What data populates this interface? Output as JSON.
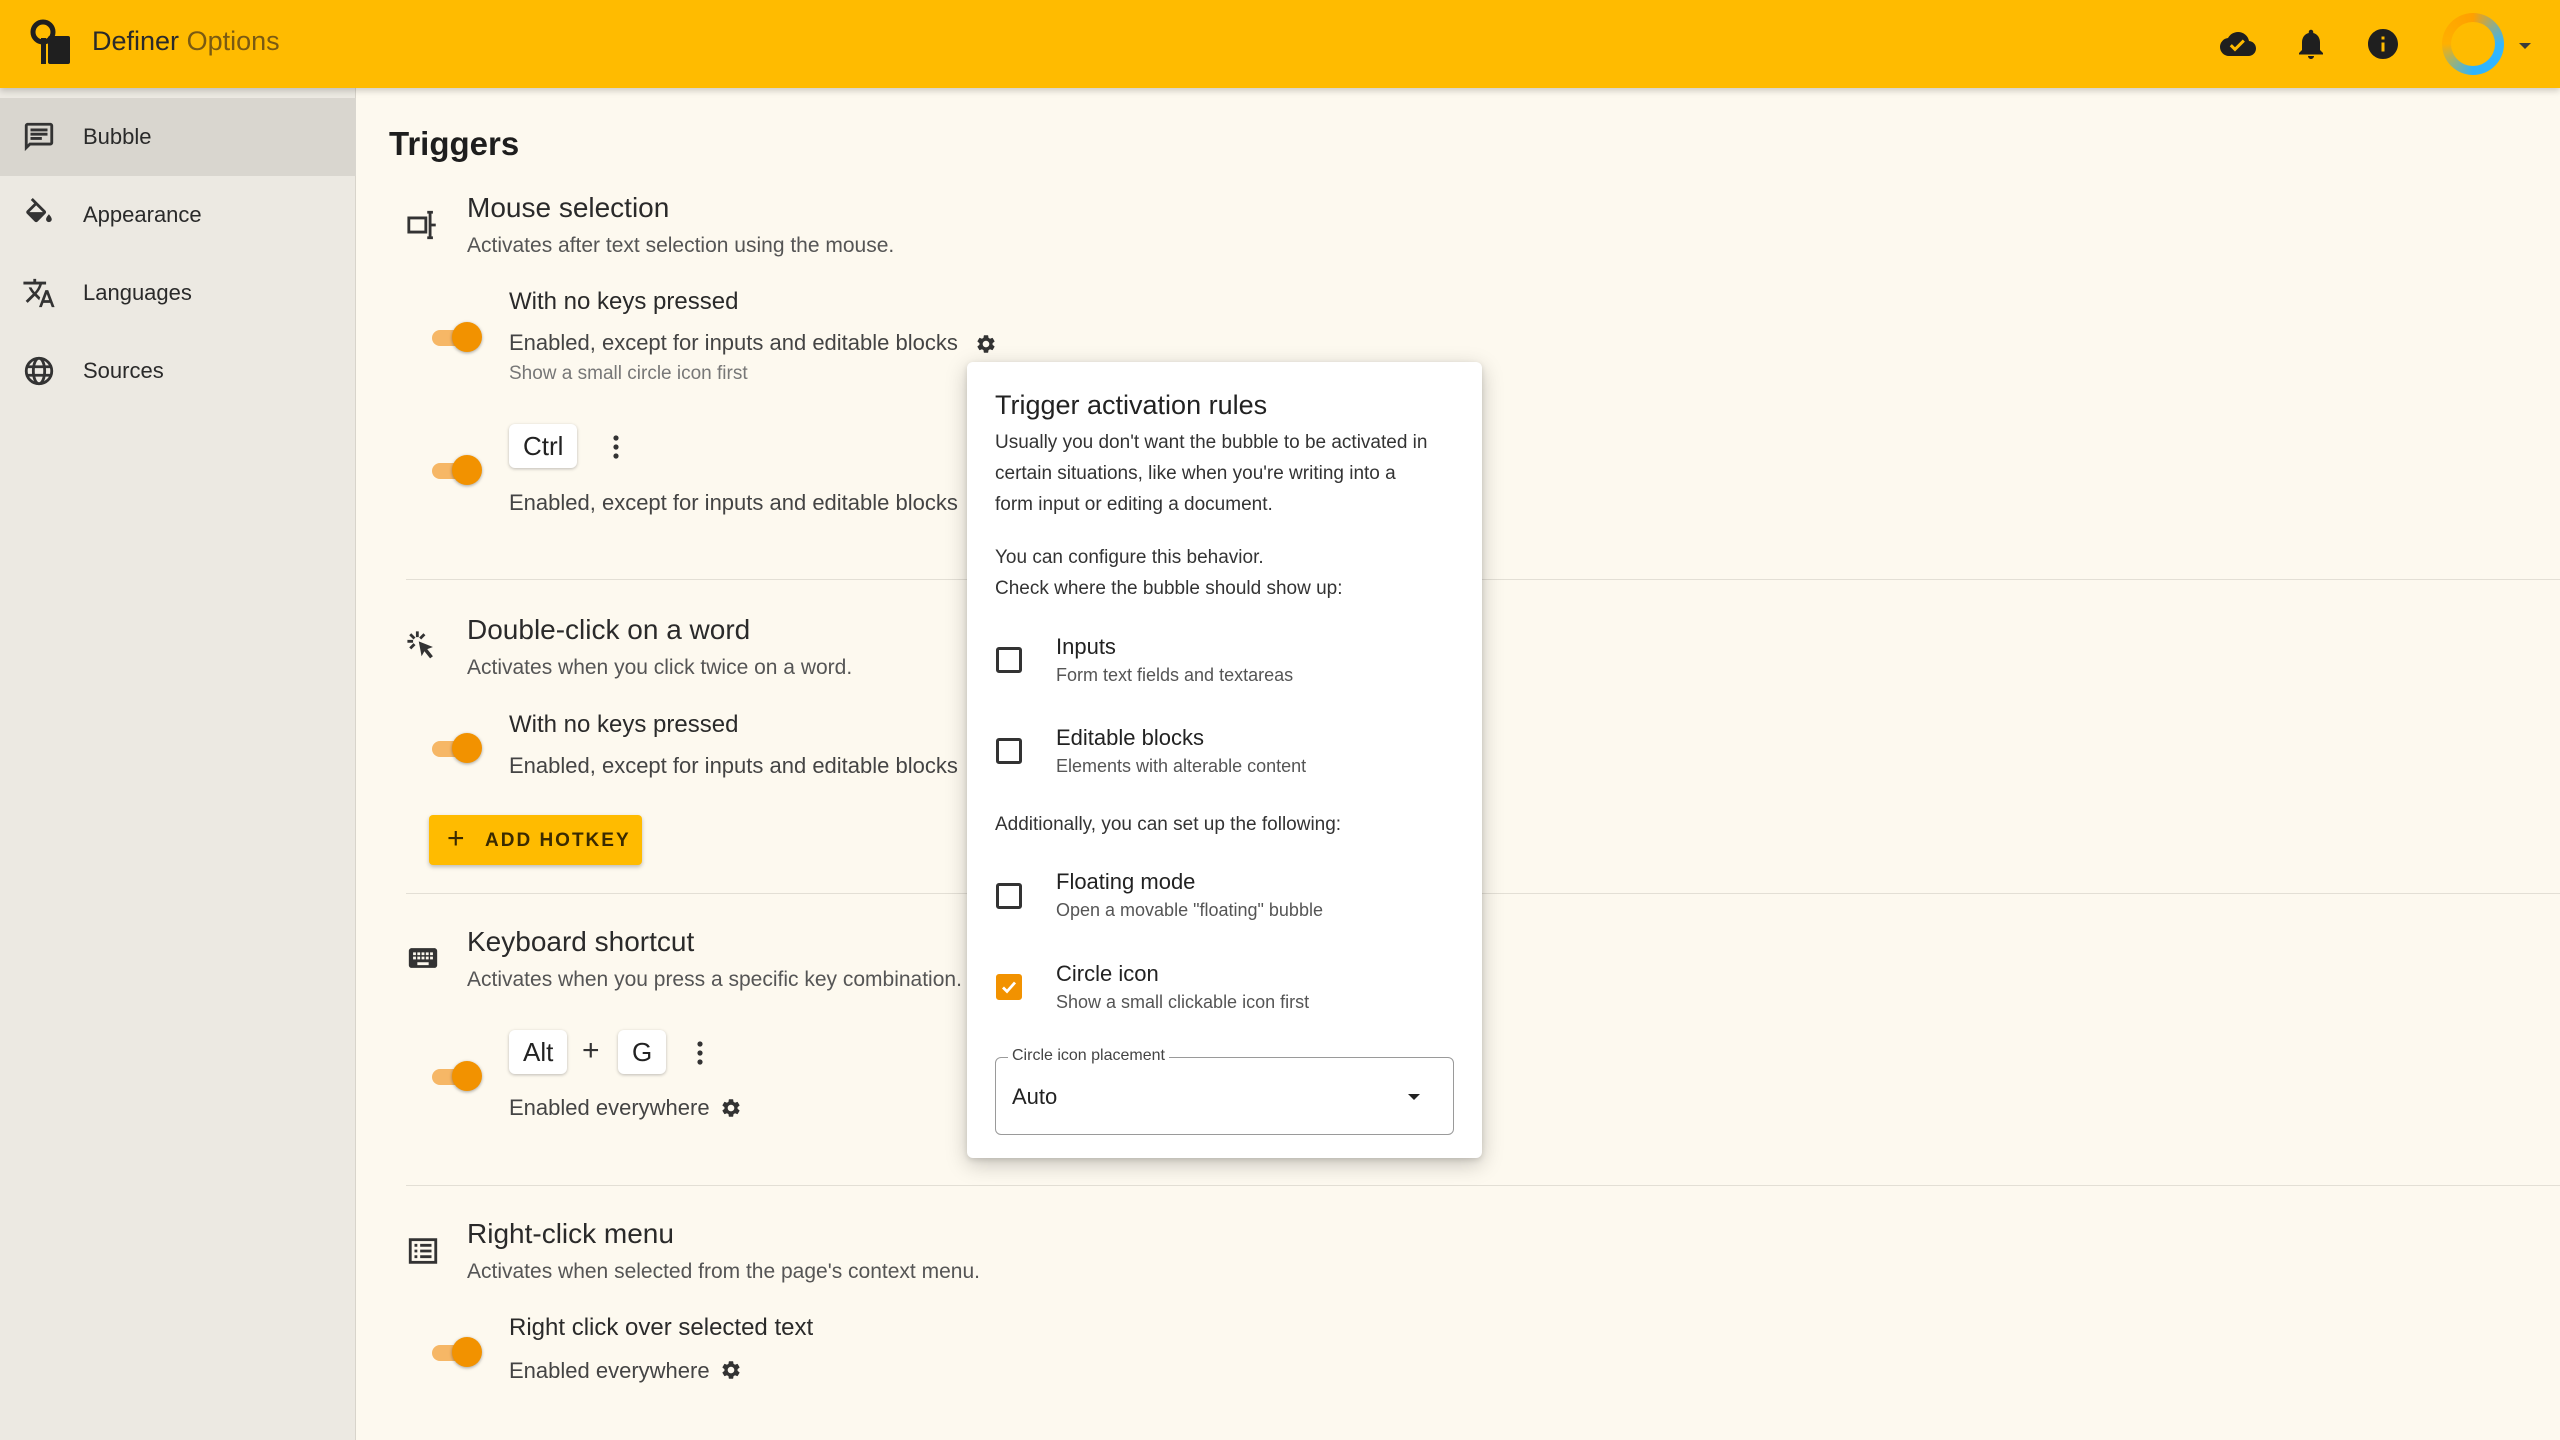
{
  "app": {
    "name": "Definer",
    "subtitle": "Options"
  },
  "topbar": {
    "icons": [
      "cloud-done-icon",
      "bell-icon",
      "info-icon"
    ]
  },
  "sidebar": {
    "items": [
      {
        "label": "Bubble",
        "icon": "message-icon",
        "active": true
      },
      {
        "label": "Appearance",
        "icon": "paint-bucket-icon",
        "active": false
      },
      {
        "label": "Languages",
        "icon": "translate-icon",
        "active": false
      },
      {
        "label": "Sources",
        "icon": "globe-icon",
        "active": false
      }
    ]
  },
  "main": {
    "title": "Triggers",
    "sections": {
      "mouse": {
        "title": "Mouse selection",
        "description": "Activates after text selection using the mouse.",
        "trigger1": {
          "name": "With no keys pressed",
          "status": "Enabled, except for inputs and editable blocks",
          "note": "Show a small circle icon first",
          "enabled": true
        },
        "trigger2": {
          "key": "Ctrl",
          "status": "Enabled, except for inputs and editable blocks",
          "enabled": true
        }
      },
      "dblclick": {
        "title": "Double-click on a word",
        "description": "Activates when you click twice on a word.",
        "trigger1": {
          "name": "With no keys pressed",
          "status": "Enabled, except for inputs and editable blocks",
          "enabled": true
        },
        "add_hotkey": "ADD HOTKEY"
      },
      "keyboard": {
        "title": "Keyboard shortcut",
        "description": "Activates when you press a specific key combination.",
        "trigger1": {
          "keys": [
            "Alt",
            "G"
          ],
          "plus": "+",
          "status": "Enabled everywhere",
          "enabled": true
        }
      },
      "rightclick": {
        "title": "Right-click menu",
        "description": "Activates when selected from the page's context menu.",
        "trigger1": {
          "name": "Right click over selected text",
          "status": "Enabled everywhere",
          "enabled": true
        }
      }
    }
  },
  "popup": {
    "title": "Trigger activation rules",
    "intro_lines": [
      "Usually you don't want the bubble to be activated in",
      "certain situations, like when you're writing into a",
      "form input or editing a document."
    ],
    "config_lines": [
      "You can configure this behavior.",
      "Check where the bubble should show up:"
    ],
    "options": [
      {
        "label": "Inputs",
        "sub": "Form text fields and textareas",
        "checked": false
      },
      {
        "label": "Editable blocks",
        "sub": "Elements with alterable content",
        "checked": false
      }
    ],
    "additional": "Additionally, you can set up the following:",
    "extra_options": [
      {
        "label": "Floating mode",
        "sub": "Open a movable \"floating\" bubble",
        "checked": false
      },
      {
        "label": "Circle icon",
        "sub": "Show a small clickable icon first",
        "checked": true
      }
    ],
    "select": {
      "label": "Circle icon placement",
      "value": "Auto"
    }
  },
  "colors": {
    "appbar": "#ffbb00",
    "accent": "#f29200",
    "sidebar": "#ece9e2",
    "background": "#fdf9ef"
  }
}
